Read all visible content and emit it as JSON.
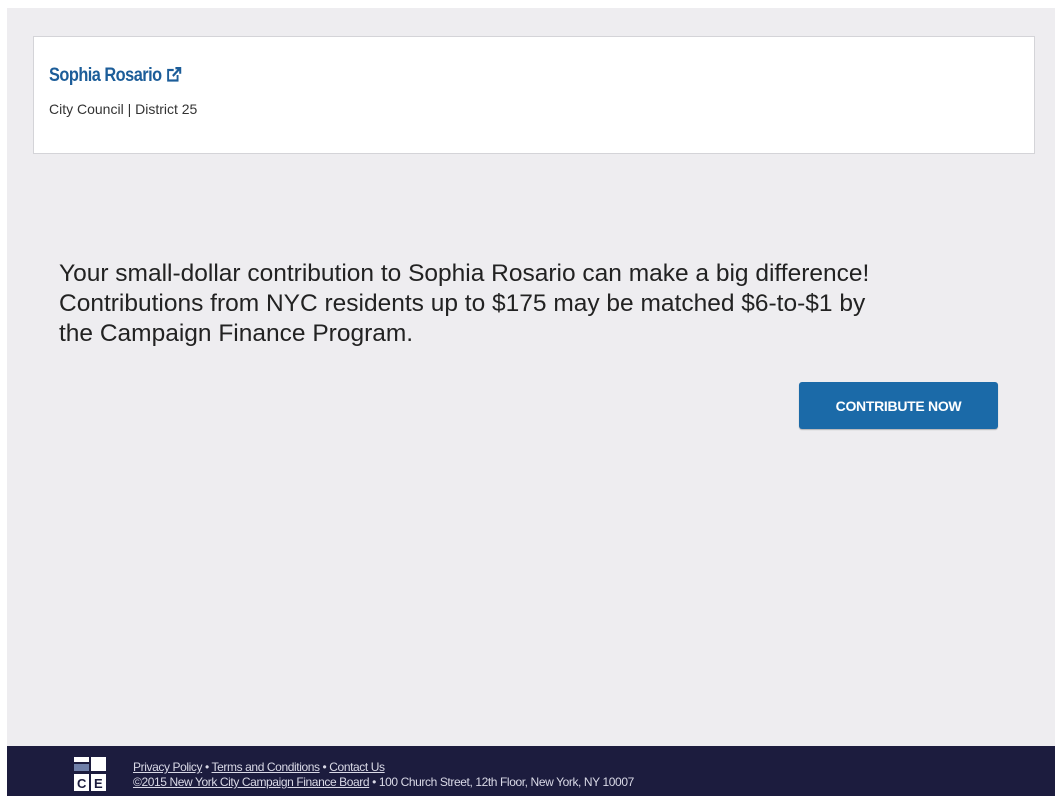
{
  "candidate": {
    "name": "Sophia Rosario",
    "office": "City Council | District 25",
    "external_link_icon": "external-link-icon"
  },
  "message": {
    "line1": "Your small-dollar contribution to Sophia Rosario can make a big difference!",
    "line2": "Contributions from NYC residents up to $175 may be matched $6-to-$1 by",
    "line3": "the Campaign Finance Program."
  },
  "cta": {
    "label": "CONTRIBUTE NOW",
    "color": "#1b6aa8"
  },
  "footer": {
    "logo_icon": "cfb-logo-icon",
    "links": {
      "privacy": "Privacy Policy",
      "terms": "Terms and Conditions",
      "contact": "Contact Us"
    },
    "separator": " • ",
    "copyright_link": "©2015 New York City Campaign Finance Board",
    "address": " • 100 Church Street, 12th Floor, New York, NY 10007",
    "background": "#1c1c3e"
  },
  "colors": {
    "page_background": "#eeedf0",
    "link_blue": "#1c5d99"
  }
}
